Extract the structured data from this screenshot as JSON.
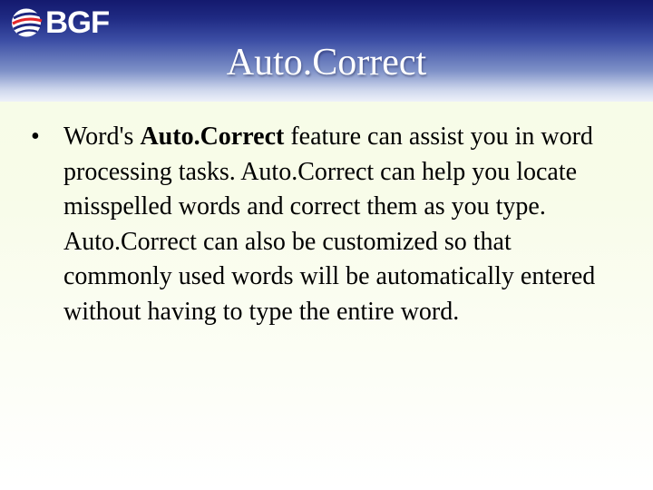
{
  "header": {
    "logo_text": "BGF",
    "title": "Auto.Correct"
  },
  "content": {
    "bullet_symbol": "•",
    "text_before": "Word's ",
    "bold_term": "Auto.Correct",
    "text_after": " feature can assist you in word processing tasks. Auto.Correct can help you locate misspelled words and correct them as you type. Auto.Correct can also be customized so that commonly used words will be automatically entered without having to type the entire word."
  },
  "colors": {
    "header_dark": "#141a6e",
    "header_light": "#eef1f9",
    "body_background": "#f6fbe6",
    "logo_red": "#e3262a"
  }
}
